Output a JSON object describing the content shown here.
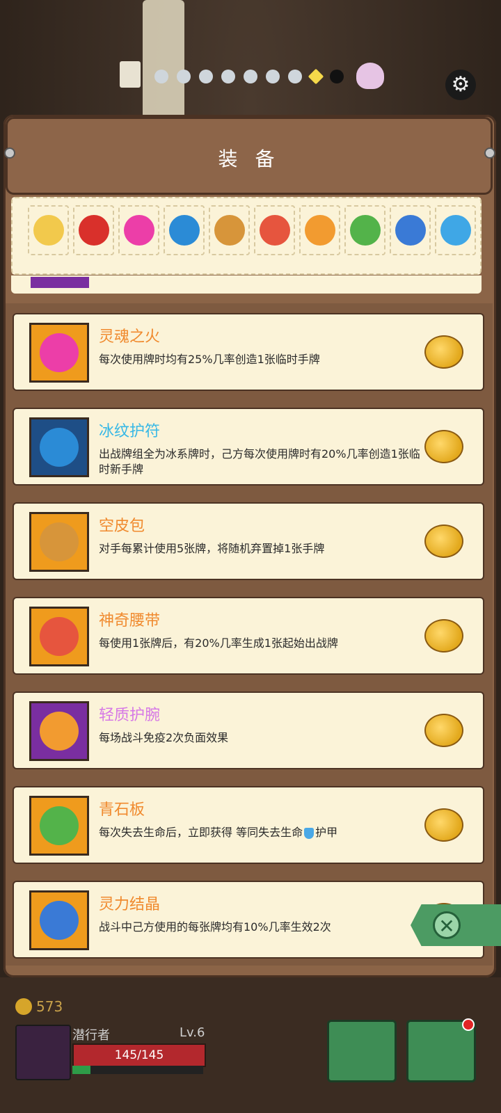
{
  "header": {
    "title": "装 备"
  },
  "strip": [
    {
      "icon": "gold-frame-icon",
      "color": "#f2c94c"
    },
    {
      "icon": "red-potion-icon",
      "color": "#d9302b"
    },
    {
      "icon": "soul-fire-icon",
      "color": "#ec3ea8"
    },
    {
      "icon": "ice-amulet-icon",
      "color": "#2b8bd6"
    },
    {
      "icon": "leather-bag-icon",
      "color": "#d7953a"
    },
    {
      "icon": "magic-belt-icon",
      "color": "#e6553e"
    },
    {
      "icon": "light-bracer-icon",
      "color": "#f29b30"
    },
    {
      "icon": "green-slate-icon",
      "color": "#53b34a"
    },
    {
      "icon": "spirit-crystal-icon",
      "color": "#3a7ad6"
    },
    {
      "icon": "blue-crystal-icon",
      "color": "#3fa7e6"
    }
  ],
  "items": [
    {
      "name": "灵魂之火",
      "desc": "每次使用牌时均有25%几率创造1张临时手牌",
      "name_color": "#f08a2e",
      "bg": "#ef9b1d",
      "icon_color": "#ec3ea8",
      "icon": "soul-fire-icon"
    },
    {
      "name": "冰纹护符",
      "desc": "出战牌组全为冰系牌时，己方每次使用牌时有20%几率创造1张临时新手牌",
      "name_color": "#36b8e6",
      "bg": "#1e4e86",
      "icon_color": "#2b8bd6",
      "icon": "ice-amulet-icon"
    },
    {
      "name": "空皮包",
      "desc": "对手每累计使用5张牌，将随机弃置掉1张手牌",
      "name_color": "#f08a2e",
      "bg": "#ef9b1d",
      "icon_color": "#d7953a",
      "icon": "leather-bag-icon"
    },
    {
      "name": "神奇腰带",
      "desc": "每使用1张牌后，有20%几率生成1张起始出战牌",
      "name_color": "#f08a2e",
      "bg": "#ef9b1d",
      "icon_color": "#e6553e",
      "icon": "magic-belt-icon"
    },
    {
      "name": "轻质护腕",
      "desc": "每场战斗免疫2次负面效果",
      "name_color": "#d678e6",
      "bg": "#7a2ea0",
      "icon_color": "#f29b30",
      "icon": "light-bracer-icon"
    },
    {
      "name": "青石板",
      "desc_a": "每次失去生命后，立即获得 等同失去生命",
      "desc_b": "护甲",
      "name_color": "#f08a2e",
      "bg": "#ef9b1d",
      "icon_color": "#53b34a",
      "icon": "green-slate-icon"
    },
    {
      "name": "灵力结晶",
      "desc": "战斗中己方使用的每张牌均有10%几率生效2次",
      "name_color": "#f08a2e",
      "bg": "#ef9b1d",
      "icon_color": "#3a7ad6",
      "icon": "spirit-crystal-icon"
    }
  ],
  "player": {
    "gold": "573",
    "name": "潜行者",
    "level": "Lv.6",
    "hp": "145/145",
    "xp_fraction": 0.14
  }
}
